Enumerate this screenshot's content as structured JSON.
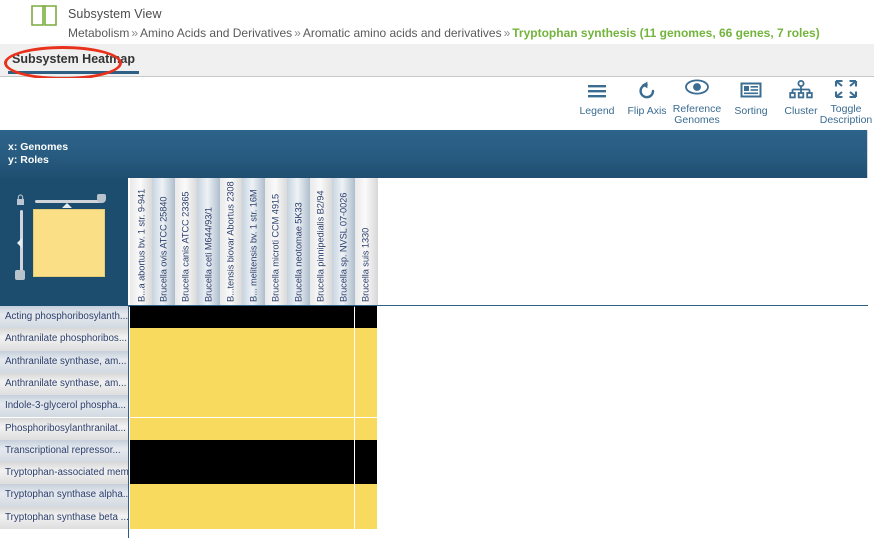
{
  "header": {
    "icon": "book-icon",
    "view_title": "Subsystem View",
    "breadcrumb": {
      "items": [
        "Metabolism",
        "Amino Acids and Derivatives",
        "Aromatic amino acids and derivatives"
      ],
      "separator": "»",
      "current": "Tryptophan synthesis (11 genomes, 66 genes, 7 roles)",
      "current_color": "#73b43c"
    }
  },
  "tabs": [
    {
      "label": "Subsystem Heatmap",
      "active": true
    }
  ],
  "annotation": {
    "shape": "ellipse",
    "color": "#e8321c",
    "target": "Subsystem Heatmap"
  },
  "toolbar": {
    "items": [
      {
        "id": "legend",
        "label": "Legend",
        "icon": "hamburger-lines-icon"
      },
      {
        "id": "flip-axis",
        "label": "Flip Axis",
        "icon": "refresh-rotate-icon"
      },
      {
        "id": "reference-genomes",
        "label_line1": "Reference",
        "label_line2": "Genomes",
        "icon": "eye-icon"
      },
      {
        "id": "sorting",
        "label": "Sorting",
        "icon": "list-window-icon"
      },
      {
        "id": "cluster",
        "label": "Cluster",
        "icon": "tree-hierarchy-icon"
      },
      {
        "id": "toggle-description",
        "label_line1": "Toggle",
        "label_line2": "Description",
        "icon": "expand-arrows-icon"
      }
    ]
  },
  "axis_banner": {
    "x_label": "x: Genomes",
    "y_label": "y: Roles",
    "background": "#275b80"
  },
  "minimap": {
    "selection_color": "#fadf86",
    "horizontal_slider": true,
    "vertical_slider": true,
    "lock_icon": "lock-icon"
  },
  "chart_data": {
    "type": "heatmap",
    "title": "Tryptophan synthesis",
    "xlabel": "x: Genomes",
    "ylabel": "y: Roles",
    "legend": {
      "present": "#f8db5e",
      "absent": "#000000"
    },
    "categories": [
      "B...a abortus bv. 1 str. 9-941",
      "Brucella ovis ATCC 25840",
      "Brucella canis ATCC 23365",
      "Brucella ceti M644/93/1",
      "B...tensis biovar Abortus 2308",
      "B... melitensis bv. 1 str. 16M",
      "Brucella microti CCM 4915",
      "Brucella neotomae 5K33",
      "Brucella pinnipedialis B2/94",
      "Brucella sp. NVSL 07-0026",
      "Brucella suis 1330"
    ],
    "rows": [
      "Acting phosphoribosylanth...",
      "Anthranilate phosphoribos...",
      "Anthranilate synthase, am...",
      "Anthranilate synthase, am...",
      "Indole-3-glycerol phospha...",
      "Phosphoribosylanthranilat...",
      "Transcriptional repressor...",
      "Tryptophan-associated mem...",
      "Tryptophan synthase alpha...",
      "Tryptophan synthase beta ..."
    ],
    "values": [
      [
        0,
        0,
        0,
        0,
        0,
        0,
        0,
        0,
        0,
        0,
        0
      ],
      [
        1,
        1,
        1,
        1,
        1,
        1,
        1,
        1,
        1,
        1,
        1
      ],
      [
        1,
        1,
        1,
        1,
        1,
        1,
        1,
        1,
        1,
        1,
        1
      ],
      [
        1,
        1,
        1,
        1,
        1,
        1,
        1,
        1,
        1,
        1,
        1
      ],
      [
        1,
        1,
        1,
        1,
        1,
        1,
        1,
        1,
        1,
        1,
        1
      ],
      [
        1,
        1,
        1,
        1,
        1,
        1,
        1,
        1,
        1,
        1,
        1
      ],
      [
        0,
        0,
        0,
        0,
        0,
        0,
        0,
        0,
        0,
        0,
        0
      ],
      [
        0,
        0,
        0,
        0,
        0,
        0,
        0,
        0,
        0,
        0,
        0
      ],
      [
        1,
        1,
        1,
        1,
        1,
        1,
        1,
        1,
        1,
        1,
        1
      ],
      [
        1,
        1,
        1,
        1,
        1,
        1,
        1,
        1,
        1,
        1,
        1
      ]
    ]
  }
}
